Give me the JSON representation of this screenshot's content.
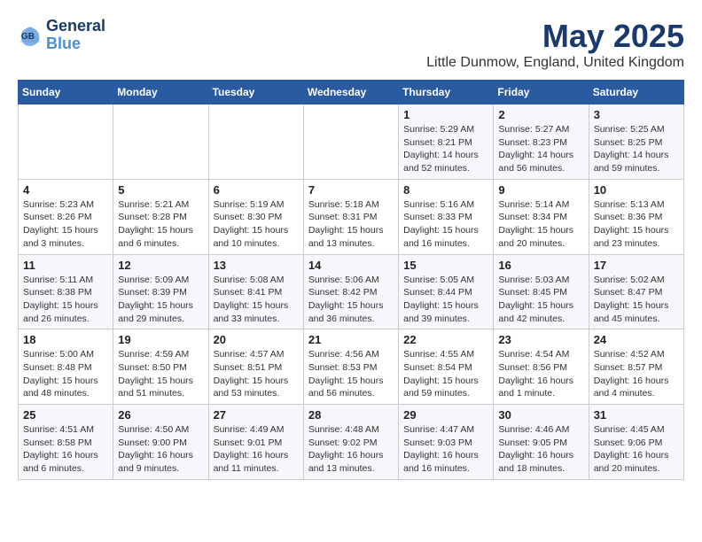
{
  "logo": {
    "line1": "General",
    "line2": "Blue"
  },
  "title": "May 2025",
  "location": "Little Dunmow, England, United Kingdom",
  "headers": [
    "Sunday",
    "Monday",
    "Tuesday",
    "Wednesday",
    "Thursday",
    "Friday",
    "Saturday"
  ],
  "weeks": [
    [
      {
        "day": "",
        "info": ""
      },
      {
        "day": "",
        "info": ""
      },
      {
        "day": "",
        "info": ""
      },
      {
        "day": "",
        "info": ""
      },
      {
        "day": "1",
        "info": "Sunrise: 5:29 AM\nSunset: 8:21 PM\nDaylight: 14 hours\nand 52 minutes."
      },
      {
        "day": "2",
        "info": "Sunrise: 5:27 AM\nSunset: 8:23 PM\nDaylight: 14 hours\nand 56 minutes."
      },
      {
        "day": "3",
        "info": "Sunrise: 5:25 AM\nSunset: 8:25 PM\nDaylight: 14 hours\nand 59 minutes."
      }
    ],
    [
      {
        "day": "4",
        "info": "Sunrise: 5:23 AM\nSunset: 8:26 PM\nDaylight: 15 hours\nand 3 minutes."
      },
      {
        "day": "5",
        "info": "Sunrise: 5:21 AM\nSunset: 8:28 PM\nDaylight: 15 hours\nand 6 minutes."
      },
      {
        "day": "6",
        "info": "Sunrise: 5:19 AM\nSunset: 8:30 PM\nDaylight: 15 hours\nand 10 minutes."
      },
      {
        "day": "7",
        "info": "Sunrise: 5:18 AM\nSunset: 8:31 PM\nDaylight: 15 hours\nand 13 minutes."
      },
      {
        "day": "8",
        "info": "Sunrise: 5:16 AM\nSunset: 8:33 PM\nDaylight: 15 hours\nand 16 minutes."
      },
      {
        "day": "9",
        "info": "Sunrise: 5:14 AM\nSunset: 8:34 PM\nDaylight: 15 hours\nand 20 minutes."
      },
      {
        "day": "10",
        "info": "Sunrise: 5:13 AM\nSunset: 8:36 PM\nDaylight: 15 hours\nand 23 minutes."
      }
    ],
    [
      {
        "day": "11",
        "info": "Sunrise: 5:11 AM\nSunset: 8:38 PM\nDaylight: 15 hours\nand 26 minutes."
      },
      {
        "day": "12",
        "info": "Sunrise: 5:09 AM\nSunset: 8:39 PM\nDaylight: 15 hours\nand 29 minutes."
      },
      {
        "day": "13",
        "info": "Sunrise: 5:08 AM\nSunset: 8:41 PM\nDaylight: 15 hours\nand 33 minutes."
      },
      {
        "day": "14",
        "info": "Sunrise: 5:06 AM\nSunset: 8:42 PM\nDaylight: 15 hours\nand 36 minutes."
      },
      {
        "day": "15",
        "info": "Sunrise: 5:05 AM\nSunset: 8:44 PM\nDaylight: 15 hours\nand 39 minutes."
      },
      {
        "day": "16",
        "info": "Sunrise: 5:03 AM\nSunset: 8:45 PM\nDaylight: 15 hours\nand 42 minutes."
      },
      {
        "day": "17",
        "info": "Sunrise: 5:02 AM\nSunset: 8:47 PM\nDaylight: 15 hours\nand 45 minutes."
      }
    ],
    [
      {
        "day": "18",
        "info": "Sunrise: 5:00 AM\nSunset: 8:48 PM\nDaylight: 15 hours\nand 48 minutes."
      },
      {
        "day": "19",
        "info": "Sunrise: 4:59 AM\nSunset: 8:50 PM\nDaylight: 15 hours\nand 51 minutes."
      },
      {
        "day": "20",
        "info": "Sunrise: 4:57 AM\nSunset: 8:51 PM\nDaylight: 15 hours\nand 53 minutes."
      },
      {
        "day": "21",
        "info": "Sunrise: 4:56 AM\nSunset: 8:53 PM\nDaylight: 15 hours\nand 56 minutes."
      },
      {
        "day": "22",
        "info": "Sunrise: 4:55 AM\nSunset: 8:54 PM\nDaylight: 15 hours\nand 59 minutes."
      },
      {
        "day": "23",
        "info": "Sunrise: 4:54 AM\nSunset: 8:56 PM\nDaylight: 16 hours\nand 1 minute."
      },
      {
        "day": "24",
        "info": "Sunrise: 4:52 AM\nSunset: 8:57 PM\nDaylight: 16 hours\nand 4 minutes."
      }
    ],
    [
      {
        "day": "25",
        "info": "Sunrise: 4:51 AM\nSunset: 8:58 PM\nDaylight: 16 hours\nand 6 minutes."
      },
      {
        "day": "26",
        "info": "Sunrise: 4:50 AM\nSunset: 9:00 PM\nDaylight: 16 hours\nand 9 minutes."
      },
      {
        "day": "27",
        "info": "Sunrise: 4:49 AM\nSunset: 9:01 PM\nDaylight: 16 hours\nand 11 minutes."
      },
      {
        "day": "28",
        "info": "Sunrise: 4:48 AM\nSunset: 9:02 PM\nDaylight: 16 hours\nand 13 minutes."
      },
      {
        "day": "29",
        "info": "Sunrise: 4:47 AM\nSunset: 9:03 PM\nDaylight: 16 hours\nand 16 minutes."
      },
      {
        "day": "30",
        "info": "Sunrise: 4:46 AM\nSunset: 9:05 PM\nDaylight: 16 hours\nand 18 minutes."
      },
      {
        "day": "31",
        "info": "Sunrise: 4:45 AM\nSunset: 9:06 PM\nDaylight: 16 hours\nand 20 minutes."
      }
    ]
  ]
}
